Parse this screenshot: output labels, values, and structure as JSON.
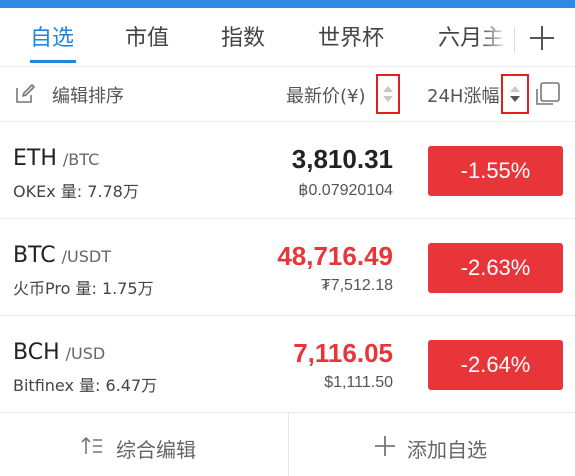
{
  "tabs": [
    {
      "label": "自选",
      "active": true
    },
    {
      "label": "市值",
      "active": false
    },
    {
      "label": "指数",
      "active": false
    },
    {
      "label": "世界杯",
      "active": false
    },
    {
      "label": "六月主",
      "active": false
    }
  ],
  "header": {
    "edit_sort_label": "编辑排序",
    "price_col_label": "最新价(¥)",
    "change_col_label": "24H涨幅"
  },
  "rows": [
    {
      "base": "ETH",
      "quote": "/BTC",
      "exchange": "OKEx 量: 7.78万",
      "price": "3,810.31",
      "price_color": "#222222",
      "subprice": "฿0.07920104",
      "change": "-1.55%"
    },
    {
      "base": "BTC",
      "quote": "/USDT",
      "exchange": "火币Pro 量: 1.75万",
      "price": "48,716.49",
      "price_color": "#e8353a",
      "subprice": "₮7,512.18",
      "change": "-2.63%"
    },
    {
      "base": "BCH",
      "quote": "/USD",
      "exchange": "Bitfinex 量: 6.47万",
      "price": "7,116.05",
      "price_color": "#e8353a",
      "subprice": "$1,111.50",
      "change": "-2.64%"
    }
  ],
  "footer": {
    "left_label": "综合编辑",
    "right_label": "添加自选"
  },
  "colors": {
    "accent": "#1f86e0",
    "down_red": "#e8353a",
    "highlight_box": "#e02020"
  },
  "icons": [
    "plus-icon",
    "edit-icon",
    "sort-arrows-icon",
    "layout-switch-icon",
    "sort-edit-icon",
    "add-icon"
  ]
}
